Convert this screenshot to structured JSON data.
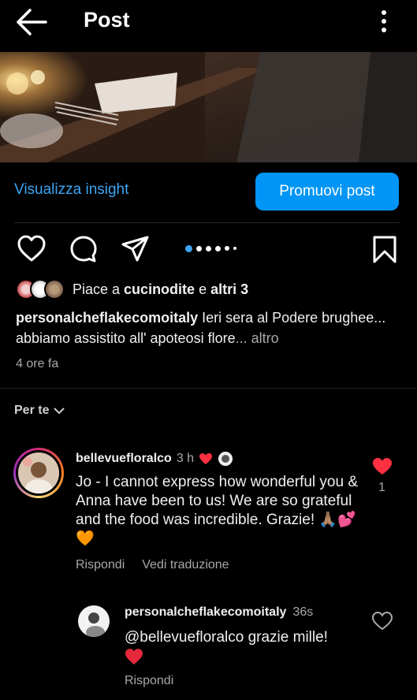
{
  "header": {
    "title": "Post",
    "back_icon": "arrow-left-icon",
    "more_icon": "more-vertical-icon"
  },
  "insights": {
    "link": "Visualizza insight",
    "promote": "Promuovi post"
  },
  "carousel": {
    "count": 6,
    "active_index": 0
  },
  "likes": {
    "prefix": "Piace a ",
    "user": "cucinodite",
    "joiner": " e ",
    "others": "altri 3"
  },
  "caption": {
    "username": "personalcheflakecomoitaly",
    "text": " Ieri sera al Podere brughee... abbiamo assistito all' apoteosi flore",
    "ellipsis": "... ",
    "more": "altro"
  },
  "post_time": "4 ore fa",
  "comments_filter": "Per te",
  "comment": {
    "username": "bellevuefloralco",
    "time": "3 h",
    "text": "Jo - I cannot express how wonderful you & Anna have been to us! We are so grateful and the food was incredible. Grazie! 🙏🏽💕🧡",
    "reply_label": "Rispondi",
    "translate_label": "Vedi traduzione",
    "like_count": "1",
    "liked": true
  },
  "reply": {
    "username": "personalcheflakecomoitaly",
    "time": "36s",
    "text": "@bellevuefloralco grazie mille!",
    "reply_label": "Rispondi"
  },
  "colors": {
    "accent_blue": "#0095f6",
    "link_blue": "#3ea6f5",
    "heart_red": "#ff3040",
    "text_muted": "#a8a8a8"
  }
}
